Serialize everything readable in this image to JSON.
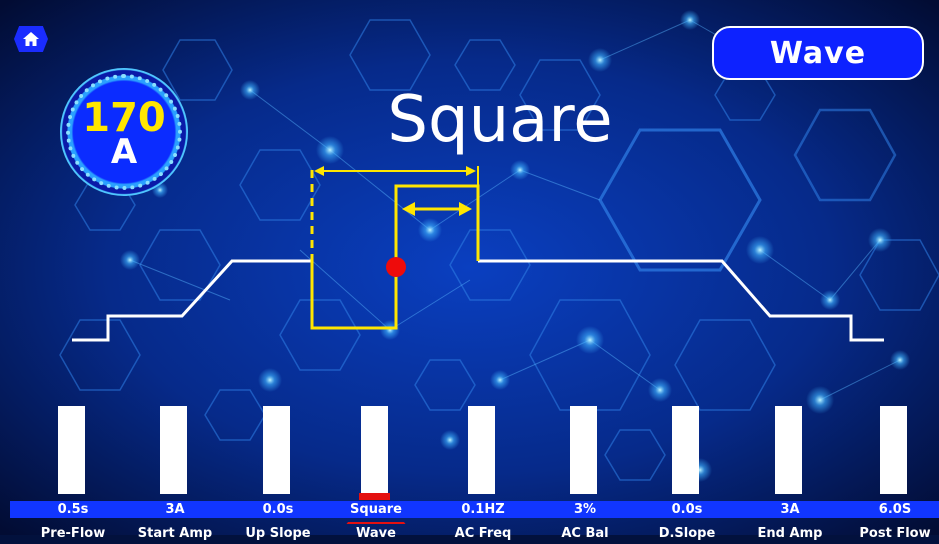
{
  "header": {
    "home_icon": "home-icon",
    "mode_label": "Wave"
  },
  "current": {
    "value": "170",
    "unit": "A"
  },
  "waveform": {
    "name": "Square"
  },
  "colors": {
    "accent_blue": "#0d22ff",
    "highlight_red": "#e41010",
    "wave_yellow": "#ffe600"
  },
  "params": [
    {
      "label": "Pre-Flow",
      "value": "0.5s",
      "level": 1.0
    },
    {
      "label": "Start Amp",
      "value": "3A",
      "level": 1.0
    },
    {
      "label": "Up Slope",
      "value": "0.0s",
      "level": 1.0
    },
    {
      "label": "Wave",
      "value": "Square",
      "level": 1.0,
      "active": true
    },
    {
      "label": "AC Freq",
      "value": "0.1HZ",
      "level": 1.0
    },
    {
      "label": "AC Bal",
      "value": "3%",
      "level": 1.0
    },
    {
      "label": "D.Slope",
      "value": "0.0s",
      "level": 1.0
    },
    {
      "label": "End Amp",
      "value": "3A",
      "level": 1.0
    },
    {
      "label": "Post Flow",
      "value": "6.0S",
      "level": 1.0
    }
  ]
}
